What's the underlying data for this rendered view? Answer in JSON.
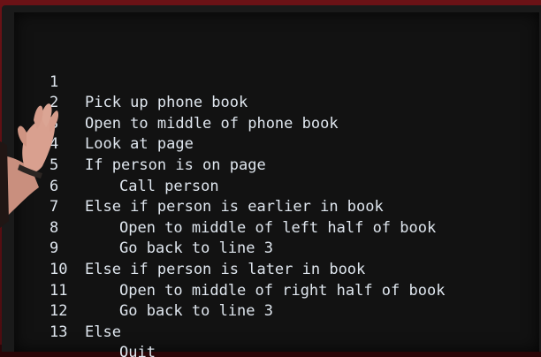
{
  "code": {
    "lines": [
      {
        "num": "1",
        "text": "Pick up phone book"
      },
      {
        "num": "2",
        "text": "Open to middle of phone book"
      },
      {
        "num": "3",
        "text": "Look at page"
      },
      {
        "num": "4",
        "text": "If person is on page"
      },
      {
        "num": "5",
        "text": "Call person"
      },
      {
        "num": "6",
        "text": "Else if person is earlier in book"
      },
      {
        "num": "7",
        "text": "Open to middle of left half of book"
      },
      {
        "num": "8",
        "text": "Go back to line 3"
      },
      {
        "num": "9",
        "text": "Else if person is later in book"
      },
      {
        "num": "10",
        "text": "Open to middle of right half of book"
      },
      {
        "num": "11",
        "text": "Go back to line 3"
      },
      {
        "num": "12",
        "text": "Else"
      },
      {
        "num": "13",
        "text": "Quit"
      }
    ]
  },
  "colors": {
    "screen_background": "#121212",
    "code_text": "#dfe6ee",
    "stage_background": "#5a0f12"
  }
}
